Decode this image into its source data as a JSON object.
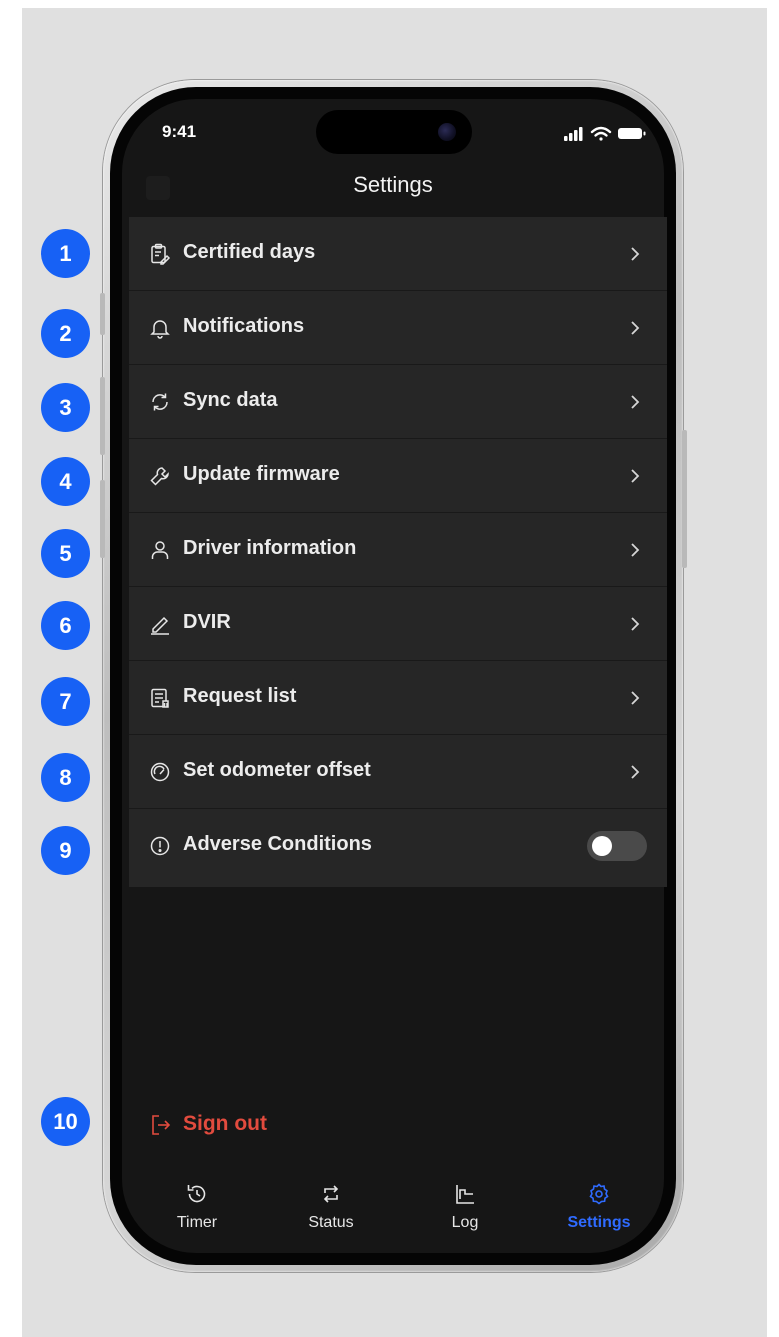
{
  "status_bar": {
    "time": "9:41"
  },
  "header": {
    "title": "Settings"
  },
  "settings": {
    "items": [
      {
        "label": "Certified days",
        "icon": "clipboard-edit-icon"
      },
      {
        "label": "Notifications",
        "icon": "bell-icon"
      },
      {
        "label": "Sync data",
        "icon": "sync-icon"
      },
      {
        "label": "Update firmware",
        "icon": "wrench-icon"
      },
      {
        "label": "Driver information",
        "icon": "user-icon"
      },
      {
        "label": "DVIR",
        "icon": "pencil-icon"
      },
      {
        "label": "Request list",
        "icon": "request-list-icon"
      },
      {
        "label": "Set odometer offset",
        "icon": "gauge-icon"
      },
      {
        "label": "Adverse Conditions",
        "icon": "alert-circle-icon",
        "toggle_on": false
      }
    ]
  },
  "sign_out": {
    "label": "Sign out",
    "color": "#e24b3e"
  },
  "tabs": [
    {
      "label": "Timer",
      "icon": "history-icon",
      "active": false
    },
    {
      "label": "Status",
      "icon": "swap-icon",
      "active": false
    },
    {
      "label": "Log",
      "icon": "chart-icon",
      "active": false
    },
    {
      "label": "Settings",
      "icon": "gear-icon",
      "active": true
    }
  ],
  "annotations": [
    "1",
    "2",
    "3",
    "4",
    "5",
    "6",
    "7",
    "8",
    "9",
    "10"
  ],
  "colors": {
    "accent": "#2f6bff",
    "badge": "#1761f5",
    "list_bg": "#262626",
    "screen_bg": "#161616"
  }
}
